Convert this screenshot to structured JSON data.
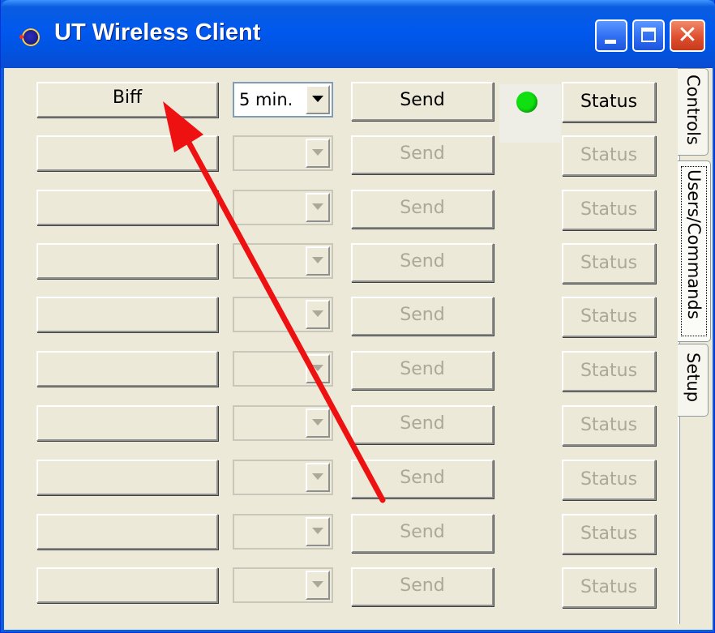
{
  "window": {
    "title": "UT Wireless Client",
    "icon": "satellite-icon",
    "controls": [
      "minimize-icon",
      "maximize-icon",
      "close-icon"
    ],
    "close_glyph": "✕"
  },
  "rows": [
    {
      "name": "Biff",
      "interval": "5 min.",
      "send": "Send",
      "status": "Status",
      "enabled": true,
      "indicator": "green"
    },
    {
      "name": "",
      "interval": "",
      "send": "Send",
      "status": "Status",
      "enabled": false
    },
    {
      "name": "",
      "interval": "",
      "send": "Send",
      "status": "Status",
      "enabled": false
    },
    {
      "name": "",
      "interval": "",
      "send": "Send",
      "status": "Status",
      "enabled": false
    },
    {
      "name": "",
      "interval": "",
      "send": "Send",
      "status": "Status",
      "enabled": false
    },
    {
      "name": "",
      "interval": "",
      "send": "Send",
      "status": "Status",
      "enabled": false
    },
    {
      "name": "",
      "interval": "",
      "send": "Send",
      "status": "Status",
      "enabled": false
    },
    {
      "name": "",
      "interval": "",
      "send": "Send",
      "status": "Status",
      "enabled": false
    },
    {
      "name": "",
      "interval": "",
      "send": "Send",
      "status": "Status",
      "enabled": false
    },
    {
      "name": "",
      "interval": "",
      "send": "Send",
      "status": "Status",
      "enabled": false
    }
  ],
  "tabs": [
    {
      "label": "Controls",
      "active": false
    },
    {
      "label": "Users/Commands",
      "active": true
    },
    {
      "label": "Setup",
      "active": false
    }
  ],
  "colors": {
    "titlebar": "#0054e3",
    "indicator_on": "#10e010",
    "annotation_arrow": "#ee1111"
  }
}
